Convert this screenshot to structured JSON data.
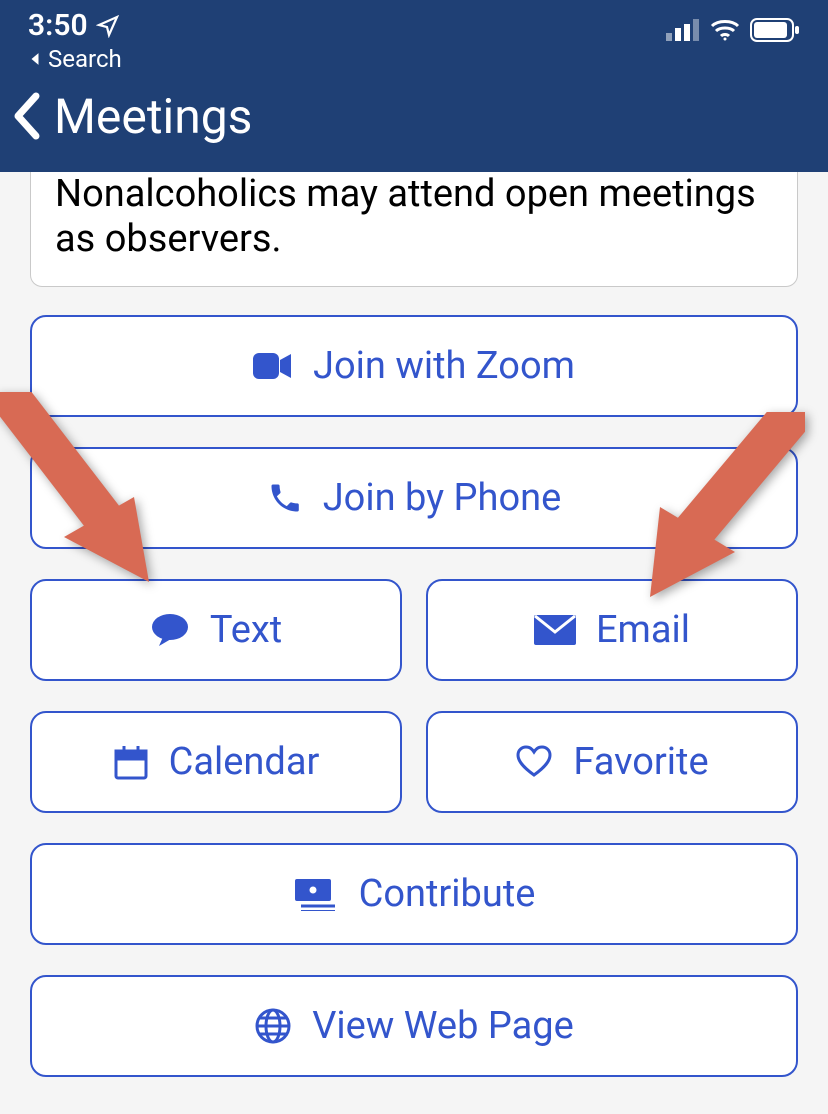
{
  "statusbar": {
    "time": "3:50",
    "back_to": "Search"
  },
  "navbar": {
    "title": "Meetings"
  },
  "info": {
    "text_visible_partial": "as observers."
  },
  "buttons": {
    "zoom": "Join with Zoom",
    "phone": "Join by Phone",
    "text": "Text",
    "email": "Email",
    "calendar": "Calendar",
    "favorite": "Favorite",
    "contribute": "Contribute",
    "webpage": "View Web Page"
  },
  "colors": {
    "accent": "#3355cc",
    "header_bg": "#1f4075",
    "annotation_arrow": "#d86a54"
  }
}
